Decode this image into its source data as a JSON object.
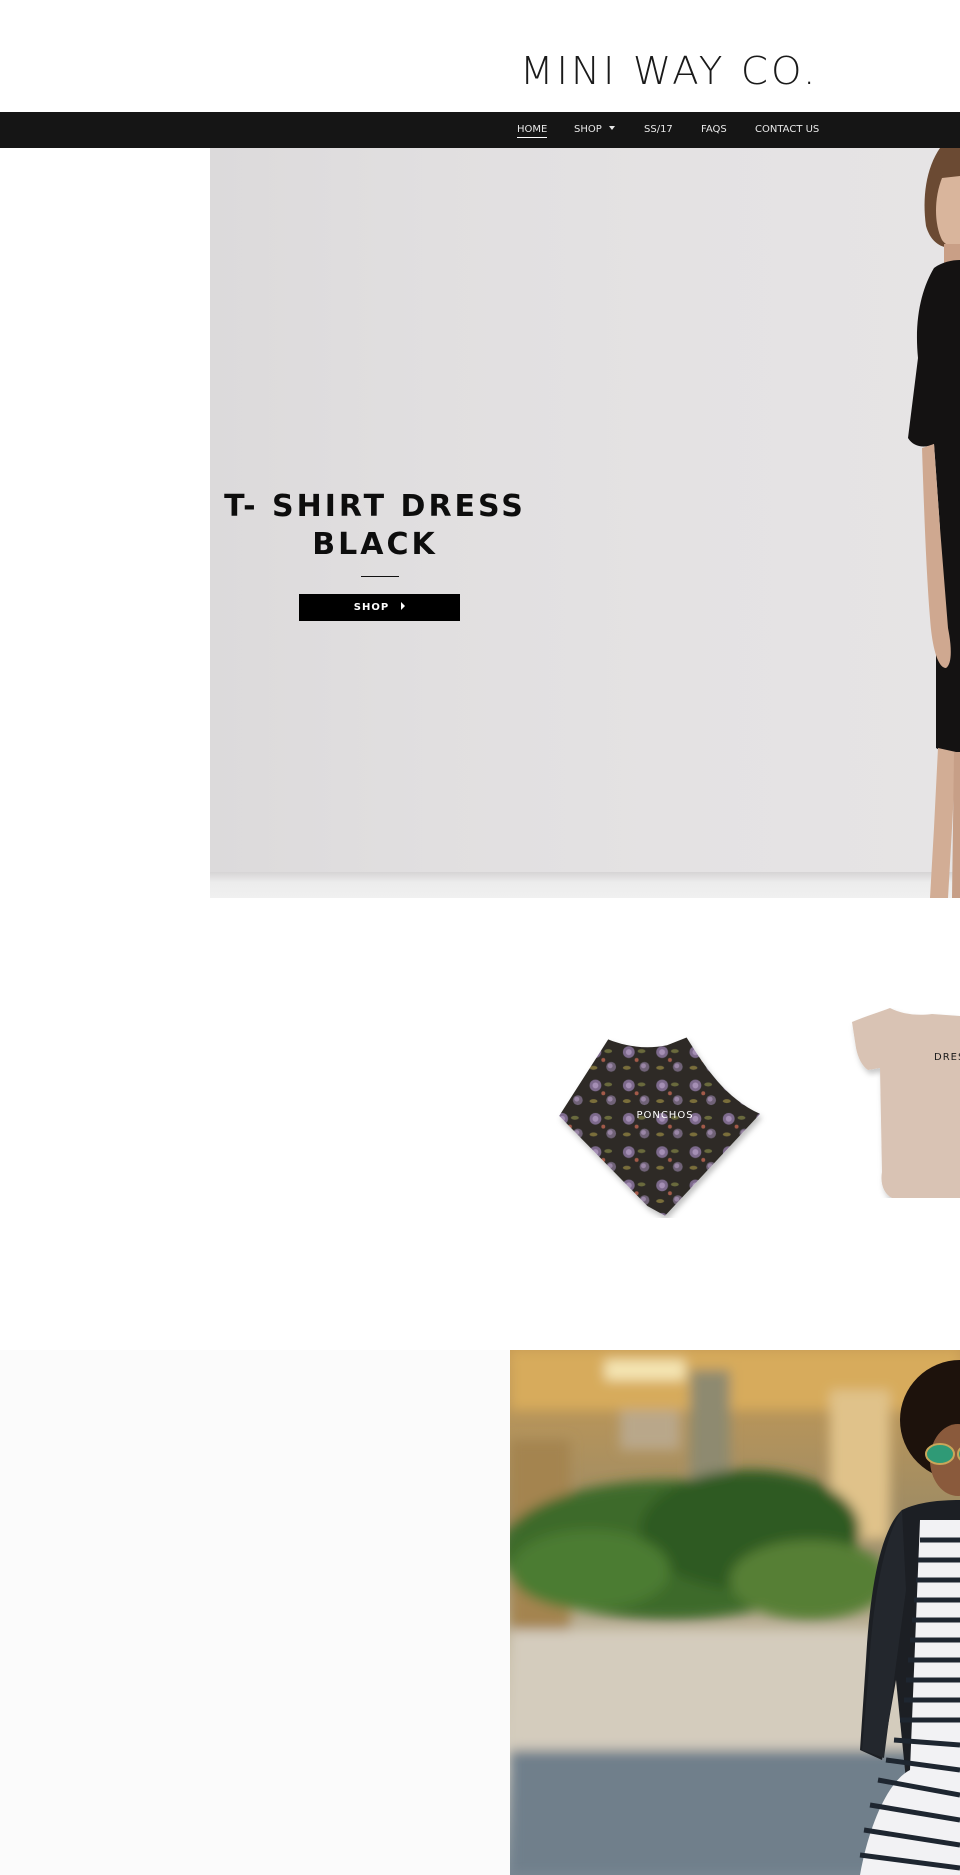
{
  "brand": {
    "logo_text": "MINI WAY CO."
  },
  "nav": {
    "items": [
      {
        "label": "HOME",
        "active": true
      },
      {
        "label": "SHOP",
        "has_dropdown": true
      },
      {
        "label": "SS/17"
      },
      {
        "label": "FAQS"
      },
      {
        "label": "CONTACT US"
      }
    ]
  },
  "hero": {
    "title": "T- SHIRT DRESS BLACK",
    "button_label": "SHOP",
    "image": "girl-in-black-tshirt-dress"
  },
  "collections": {
    "items": [
      {
        "label": "PONCHOS",
        "image": "floral-poncho"
      },
      {
        "label": "DRES",
        "image": "beige-tshirt-dress"
      }
    ]
  },
  "lifestyle": {
    "image": "girl-in-leather-jacket-striped-dress"
  },
  "colors": {
    "nav_bg": "#151515",
    "button_bg": "#000000",
    "text_dark": "#0d0d0d",
    "hero_bg": "#e2e0e1"
  },
  "icons": {
    "dropdown": "caret-down-icon",
    "button_arrow": "caret-right-icon"
  }
}
